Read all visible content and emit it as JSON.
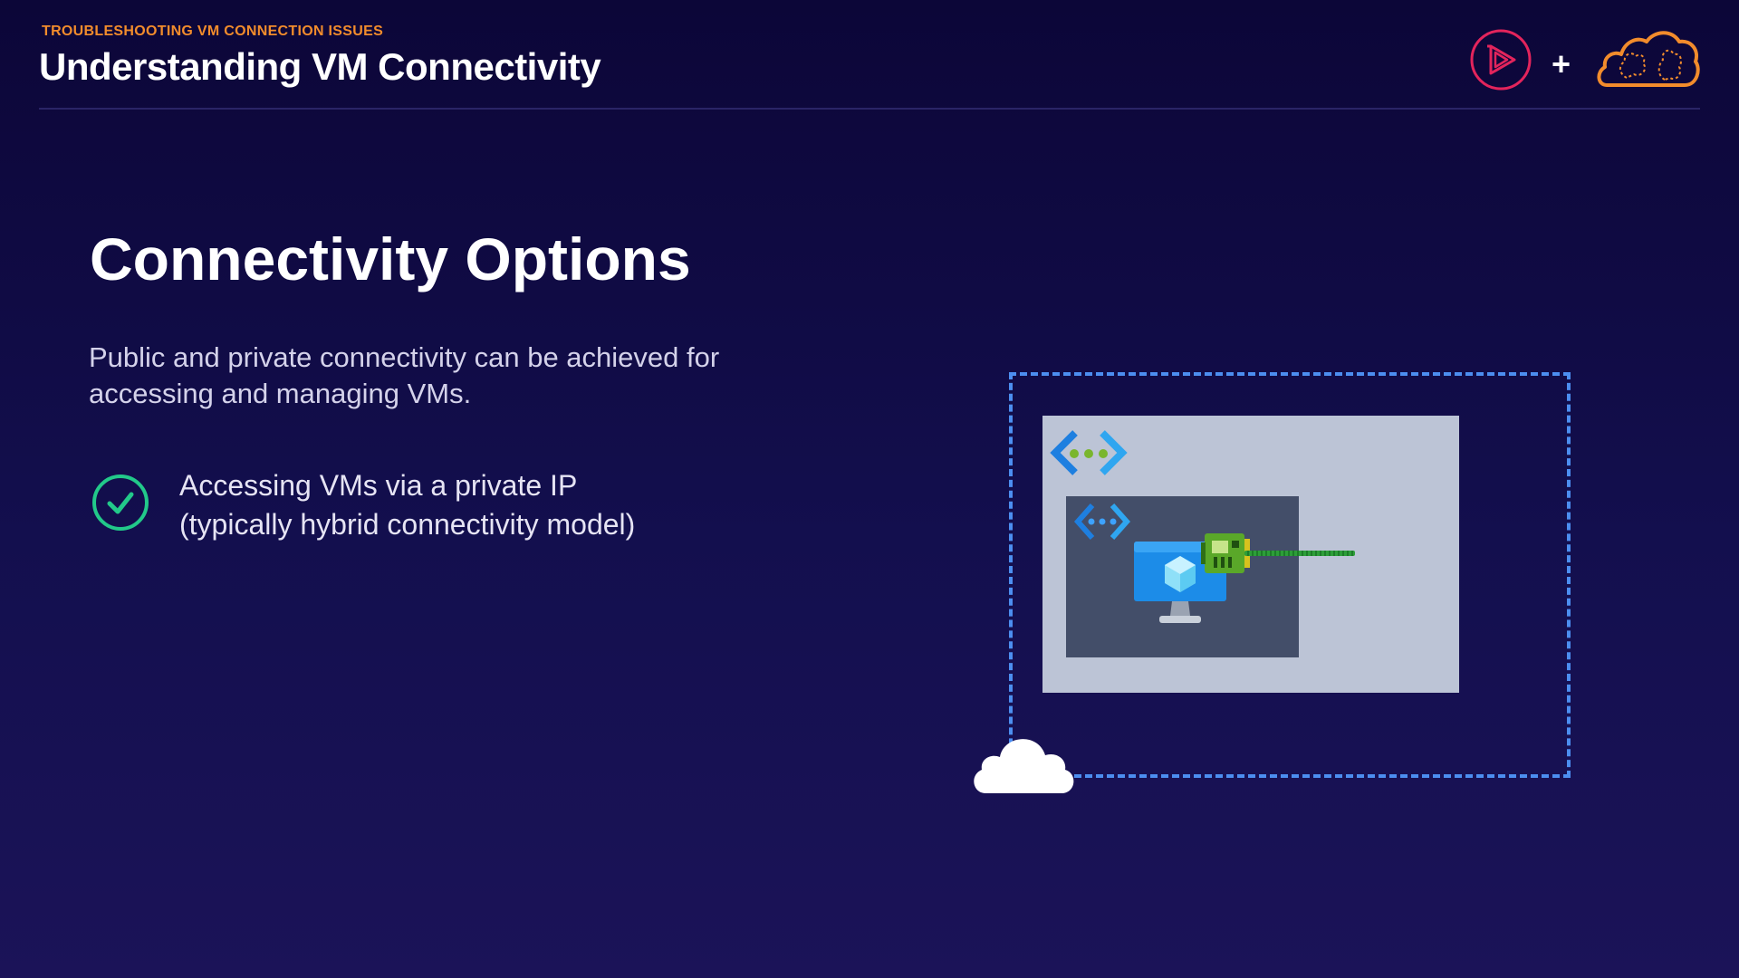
{
  "header": {
    "kicker": "TROUBLESHOOTING VM CONNECTION ISSUES",
    "title": "Understanding VM Connectivity"
  },
  "brand": {
    "play_icon": "pluralsight-play-icon",
    "plus": "+",
    "cloud_icon": "cloud-brain-icon",
    "play_color": "#e3245c",
    "cloud_color": "#f28c2c"
  },
  "slide": {
    "title": "Connectivity Options",
    "description": "Public and private connectivity can be achieved for accessing and managing VMs.",
    "bullets": [
      {
        "icon": "check-circle-icon",
        "text_line1": "Accessing VMs via a private IP",
        "text_line2": "(typically hybrid connectivity model)"
      }
    ]
  },
  "diagram": {
    "boundary_color": "#4c8ef0",
    "vnet_color": "#bcc4d6",
    "subnet_color": "#434e69",
    "icons": [
      "virtual-network-icon",
      "subnet-icon",
      "virtual-machine-icon",
      "network-interface-icon",
      "cloud-icon"
    ]
  }
}
